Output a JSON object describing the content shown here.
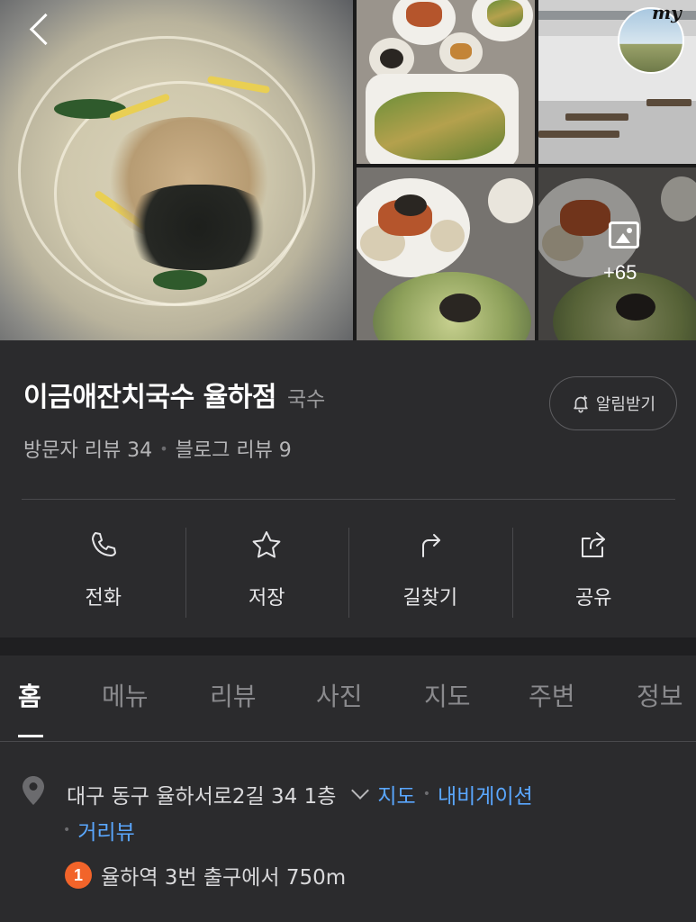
{
  "header": {
    "back_icon": "chevron-left-icon",
    "my_label": "my"
  },
  "photos": {
    "more_count": "+65",
    "more_icon": "image-icon"
  },
  "place": {
    "name": "이금애잔치국수 율하점",
    "category": "국수",
    "visitor_reviews": "방문자 리뷰 34",
    "blog_reviews": "블로그 리뷰 9",
    "alarm_label": "알림받기",
    "alarm_icon": "bell-plus-icon"
  },
  "actions": [
    {
      "label": "전화",
      "icon": "phone-icon"
    },
    {
      "label": "저장",
      "icon": "star-icon"
    },
    {
      "label": "길찾기",
      "icon": "directions-icon"
    },
    {
      "label": "공유",
      "icon": "share-icon"
    }
  ],
  "tabs": [
    {
      "label": "홈",
      "active": true
    },
    {
      "label": "메뉴",
      "active": false
    },
    {
      "label": "리뷰",
      "active": false
    },
    {
      "label": "사진",
      "active": false
    },
    {
      "label": "지도",
      "active": false
    },
    {
      "label": "주변",
      "active": false
    },
    {
      "label": "정보",
      "active": false
    }
  ],
  "address": {
    "text": "대구 동구 율하서로2길 34 1층",
    "map_link": "지도",
    "navigation_link": "내비게이션",
    "streetview_link": "거리뷰",
    "subway_line": "1",
    "subway_line_color": "#f2642a",
    "subway_directions": "율하역 3번 출구에서 750m"
  },
  "colors": {
    "background": "#2b2b2d",
    "link": "#5aa7ff",
    "text_primary": "#ffffff",
    "text_secondary": "#b5b5b7"
  }
}
